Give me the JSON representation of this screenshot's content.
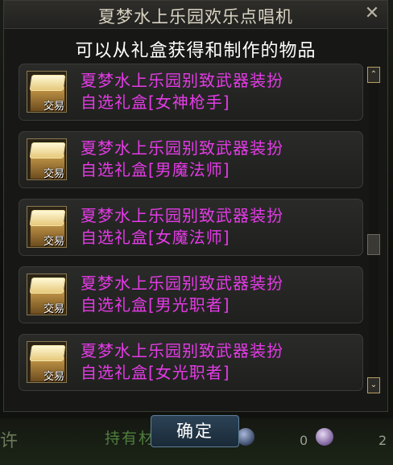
{
  "window": {
    "title": "夏梦水上乐园欢乐点唱机",
    "close_glyph": "✕",
    "subtitle": "可以从礼盒获得和制作的物品"
  },
  "items": [
    {
      "icon": "gift-box-icon",
      "badge": "交易",
      "line1": "夏梦水上乐园别致武器装扮",
      "line2": "自选礼盒[女神枪手]"
    },
    {
      "icon": "gift-box-icon",
      "badge": "交易",
      "line1": "夏梦水上乐园别致武器装扮",
      "line2": "自选礼盒[男魔法师]"
    },
    {
      "icon": "gift-box-icon",
      "badge": "交易",
      "line1": "夏梦水上乐园别致武器装扮",
      "line2": "自选礼盒[女魔法师]"
    },
    {
      "icon": "gift-box-icon",
      "badge": "交易",
      "line1": "夏梦水上乐园别致武器装扮",
      "line2": "自选礼盒[男光职者]"
    },
    {
      "icon": "gift-box-icon",
      "badge": "交易",
      "line1": "夏梦水上乐园别致武器装扮",
      "line2": "自选礼盒[女光职者]"
    }
  ],
  "scrollbar": {
    "up_glyph": "⌃",
    "down_glyph": "⌄",
    "position_fraction": 0.55
  },
  "confirm_button": {
    "label": "确定"
  },
  "background_peek": {
    "left_text": "许",
    "mid_text": "持有材",
    "count1": "0",
    "count2": "2"
  },
  "colors": {
    "item_text": "#e43be6",
    "title": "#d9d3c2",
    "subtitle": "#ffffff",
    "button": "#2b4256"
  }
}
